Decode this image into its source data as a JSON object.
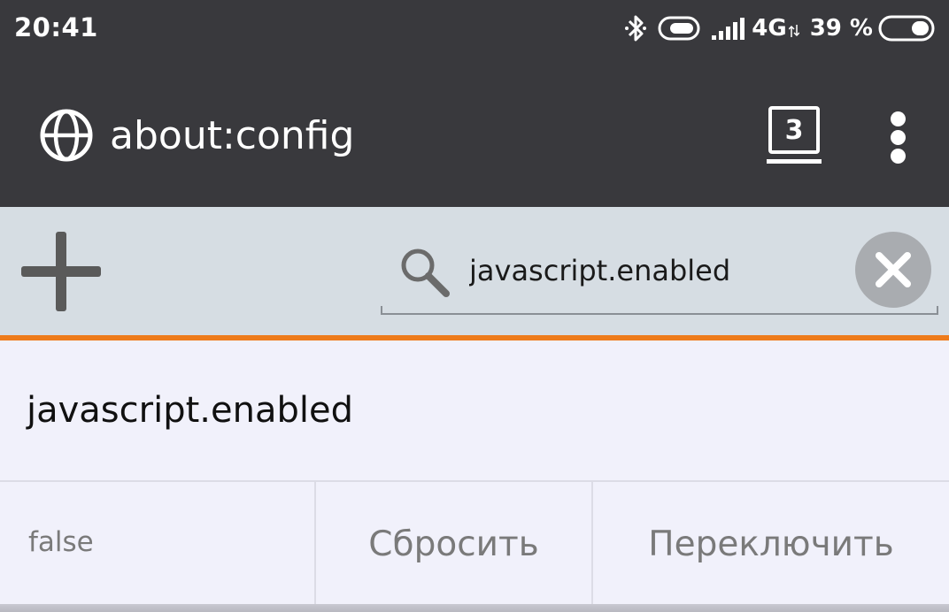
{
  "status_bar": {
    "time": "20:41",
    "network": "4G",
    "battery_percent": "39 %",
    "icons": [
      "bluetooth-icon",
      "toggle-icon",
      "signal-icon",
      "battery-icon"
    ]
  },
  "app_bar": {
    "url": "about:config",
    "tab_count": "3",
    "icons": [
      "globe-icon",
      "tabs-icon",
      "overflow-menu-icon"
    ]
  },
  "toolbar": {
    "search_value": "javascript.enabled",
    "icons": [
      "add-icon",
      "search-icon",
      "clear-icon"
    ]
  },
  "preference": {
    "name": "javascript.enabled",
    "value": "false",
    "reset_label": "Сбросить",
    "toggle_label": "Переключить"
  },
  "colors": {
    "chrome_bg": "#39393d",
    "toolbar_bg": "#d6dde3",
    "accent": "#ee7b1b",
    "content_bg": "#f1f1fb"
  }
}
